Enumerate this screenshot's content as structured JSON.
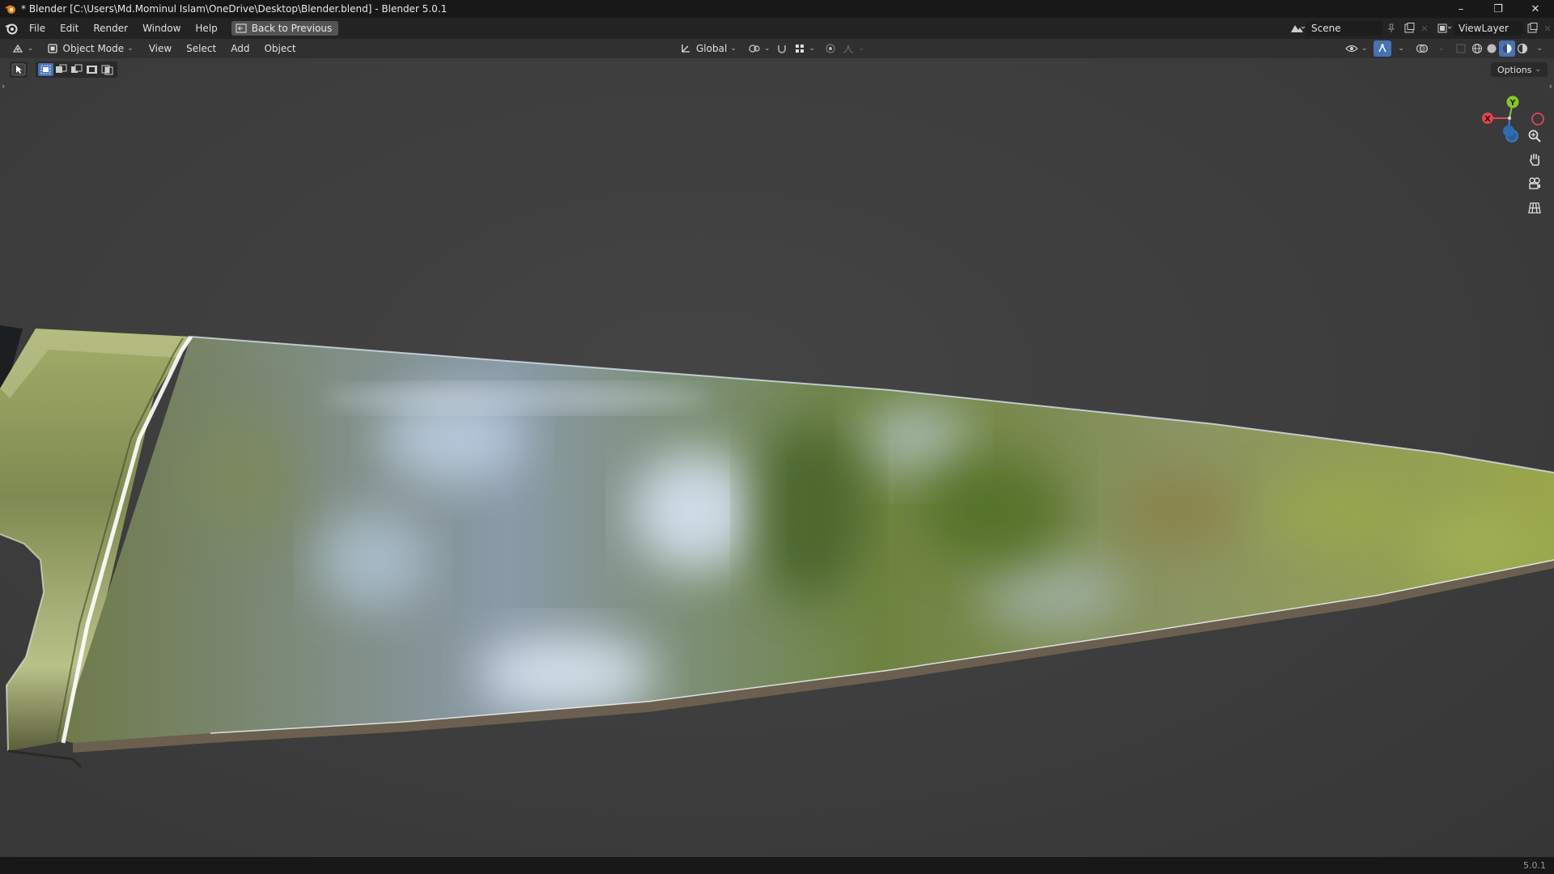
{
  "window": {
    "title": "* Blender [C:\\Users\\Md.Mominul Islam\\OneDrive\\Desktop\\Blender.blend] - Blender 5.0.1"
  },
  "menu": {
    "items": [
      "File",
      "Edit",
      "Render",
      "Window",
      "Help"
    ],
    "back_label": "Back to Previous"
  },
  "scene": {
    "name": "Scene"
  },
  "view_layer": {
    "name": "ViewLayer"
  },
  "viewport_header": {
    "mode": "Object Mode",
    "menus": [
      "View",
      "Select",
      "Add",
      "Object"
    ],
    "transform_orientation": "Global"
  },
  "viewport": {
    "options_label": "Options",
    "gizmo_axes": {
      "x": "X",
      "y": "Y"
    }
  },
  "status": {
    "version": "5.0.1"
  },
  "colors": {
    "accent": "#4772b3",
    "axis_x": "#e0464e",
    "axis_y": "#8cc42d",
    "axis_z": "#3b84d8"
  }
}
